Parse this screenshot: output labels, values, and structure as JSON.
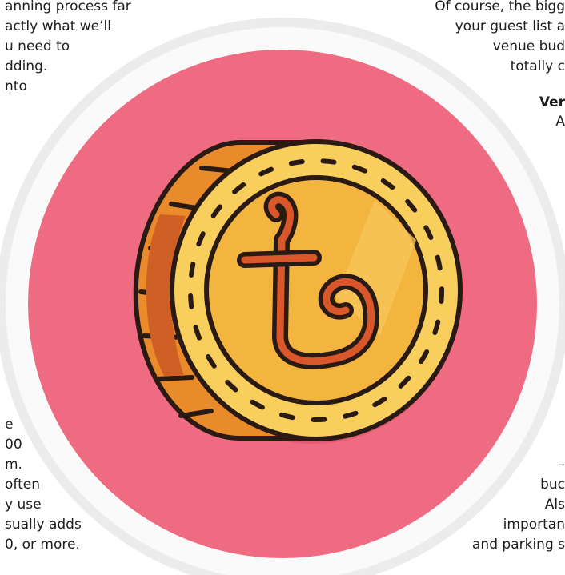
{
  "colors": {
    "disc_fill": "#ef6b82",
    "ring": "#e4e4e4",
    "coin_face": "#f4b53e",
    "coin_rim": "#f8cf5c",
    "coin_edge": "#e98b2a",
    "coin_edge_dark": "#cf5f24",
    "outline": "#2a1a14",
    "symbol": "#d9572b",
    "background": "#ffffff",
    "text": "#1d1d1b"
  },
  "icons": {
    "coin": "baht-coin-icon"
  },
  "article": {
    "left_top": [
      "anning process far",
      "actly what we’ll",
      "u need to",
      "dding.",
      "nto"
    ],
    "left_bottom": [
      "e",
      "00",
      "m.",
      "often",
      "y use",
      "sually adds",
      "0, or more."
    ],
    "right_top": [
      "Of course, the bigg",
      "your guest list a",
      "venue bud",
      "totally c"
    ],
    "right_heading": "Ver",
    "right_heading_next": "A",
    "right_bottom": [
      "–",
      "buc",
      "Als",
      "importan",
      "and parking s"
    ]
  }
}
